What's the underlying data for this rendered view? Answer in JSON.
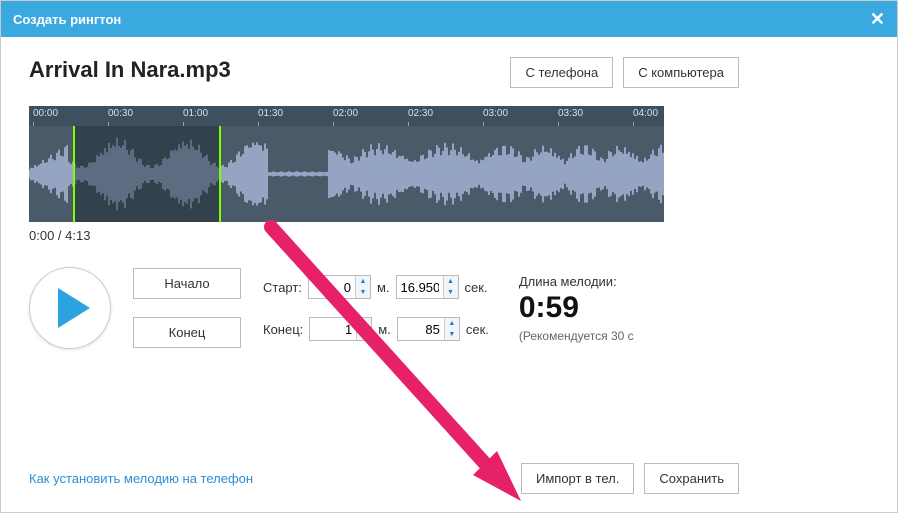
{
  "window": {
    "title": "Создать рингтон"
  },
  "file": {
    "name": "Arrival In Nara.mp3"
  },
  "source_buttons": {
    "from_phone": "С телефона",
    "from_computer": "С компьютера"
  },
  "timeline_ticks": [
    "00:00",
    "00:30",
    "01:00",
    "01:30",
    "02:00",
    "02:30",
    "03:00",
    "03:30",
    "04:00"
  ],
  "playback": {
    "position": "0:00 / 4:13"
  },
  "selection_buttons": {
    "start": "Начало",
    "end": "Конец"
  },
  "time_fields": {
    "start_label": "Старт:",
    "start_min": "0",
    "start_sec": "16.950",
    "end_label": "Конец:",
    "end_min": "1",
    "end_sec": "85",
    "min_unit": "м.",
    "sec_unit": "сек."
  },
  "length": {
    "label": "Длина мелодии:",
    "value": "0:59",
    "note": "(Рекомендуется 30 с"
  },
  "footer": {
    "help_link": "Как установить мелодию на телефон",
    "import": "Импорт в тел.",
    "save": "Сохранить"
  }
}
